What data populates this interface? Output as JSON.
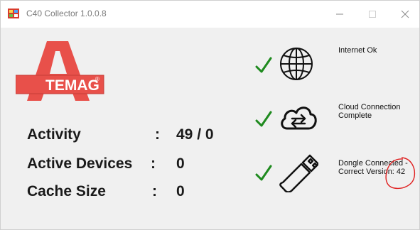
{
  "window": {
    "title": "C40 Collector 1.0.0.8"
  },
  "logo": {
    "letter": "A",
    "text": "TEMAG",
    "registered": "®",
    "brand_color": "#e8504a"
  },
  "stats": [
    {
      "label": "Activity",
      "colon": ":",
      "value": "49 / 0"
    },
    {
      "label": "Active Devices",
      "colon": ":",
      "value": "0"
    },
    {
      "label": "Cache Size",
      "colon": ":",
      "value": "0"
    }
  ],
  "status": {
    "internet": {
      "icon": "globe-icon",
      "text": "Internet Ok"
    },
    "cloud": {
      "icon": "cloud-sync-icon",
      "line1": "Cloud Connection",
      "line2": "Complete"
    },
    "dongle": {
      "icon": "usb-dongle-icon",
      "line1": "Dongle Connected -",
      "line2": "Correct Version: 42"
    },
    "check_color": "#1e8a1e"
  },
  "annotation": {
    "color": "#e02020"
  }
}
